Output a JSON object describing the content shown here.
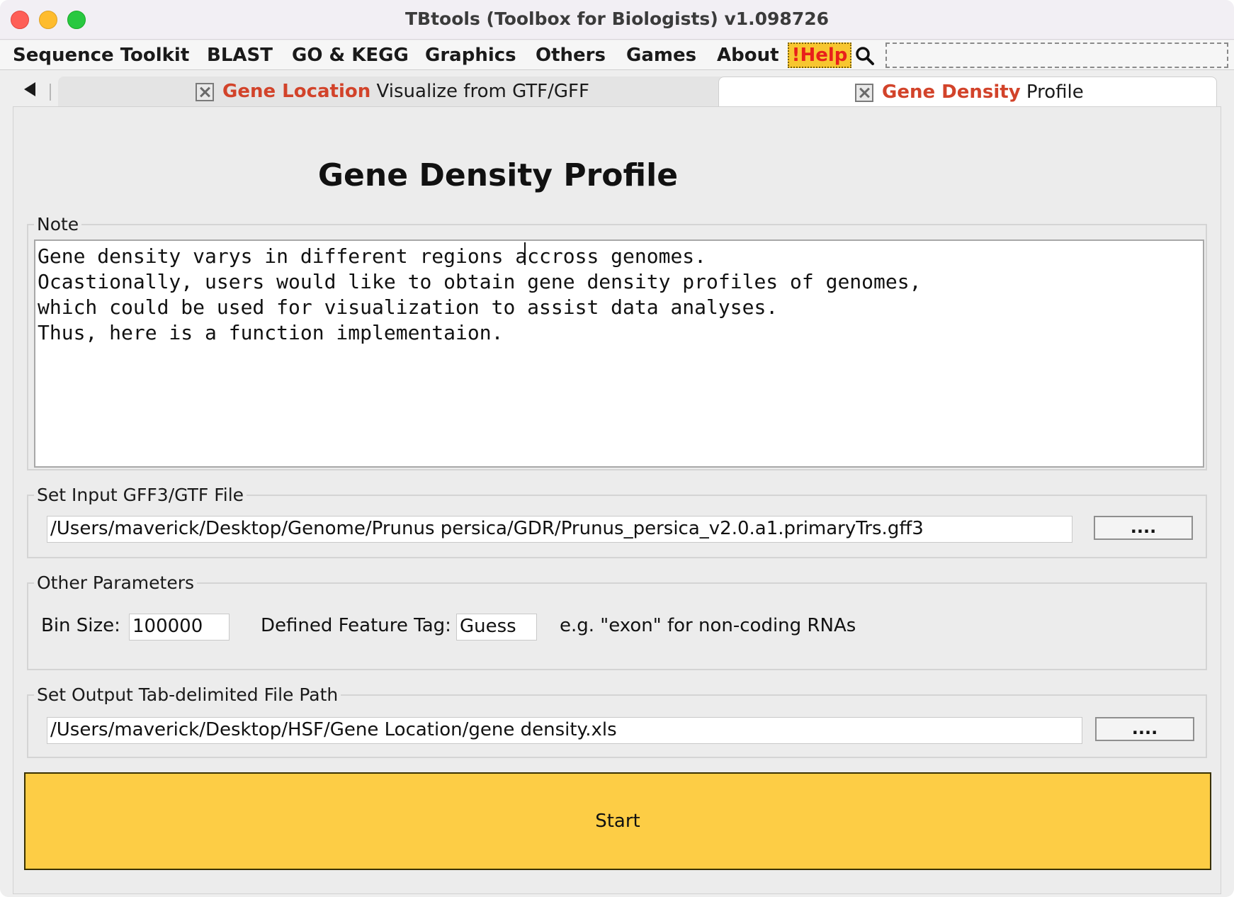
{
  "window": {
    "title": "TBtools (Toolbox for Biologists) v1.098726"
  },
  "menu": {
    "items": [
      "Sequence Toolkit",
      "BLAST",
      "GO & KEGG",
      "Graphics",
      "Others",
      "Games",
      "About"
    ],
    "help_label": "!Help",
    "search_placeholder": ""
  },
  "tabs": [
    {
      "highlight": "Gene Location",
      "rest": " Visualize from GTF/GFF",
      "active": false
    },
    {
      "highlight": "Gene Density",
      "rest": " Profile",
      "active": true
    }
  ],
  "page": {
    "title": "Gene Density Profile"
  },
  "note": {
    "label": "Note",
    "text": "Gene density varys in different regions accross genomes.\nOcastionally, users would like to obtain gene density profiles of genomes,\nwhich could be used for visualization to assist data analyses.\nThus, here is a function implementaion."
  },
  "input_file": {
    "label": "Set Input GFF3/GTF File",
    "value": "/Users/maverick/Desktop/Genome/Prunus persica/GDR/Prunus_persica_v2.0.a1.primaryTrs.gff3",
    "browse_label": "...."
  },
  "parameters": {
    "label": "Other Parameters",
    "bin_size_label": "Bin Size:",
    "bin_size_value": "100000",
    "feature_tag_label": "Defined Feature Tag:",
    "feature_tag_value": "Guess",
    "feature_tag_hint": "e.g. \"exon\" for non-coding RNAs"
  },
  "output_file": {
    "label": "Set Output Tab-delimited File Path",
    "value": "/Users/maverick/Desktop/HSF/Gene Location/gene density.xls",
    "browse_label": "...."
  },
  "start_label": "Start",
  "colors": {
    "accent_red": "#d2432a",
    "start_yellow": "#fdcd45",
    "help_yellow": "#f7c630"
  }
}
